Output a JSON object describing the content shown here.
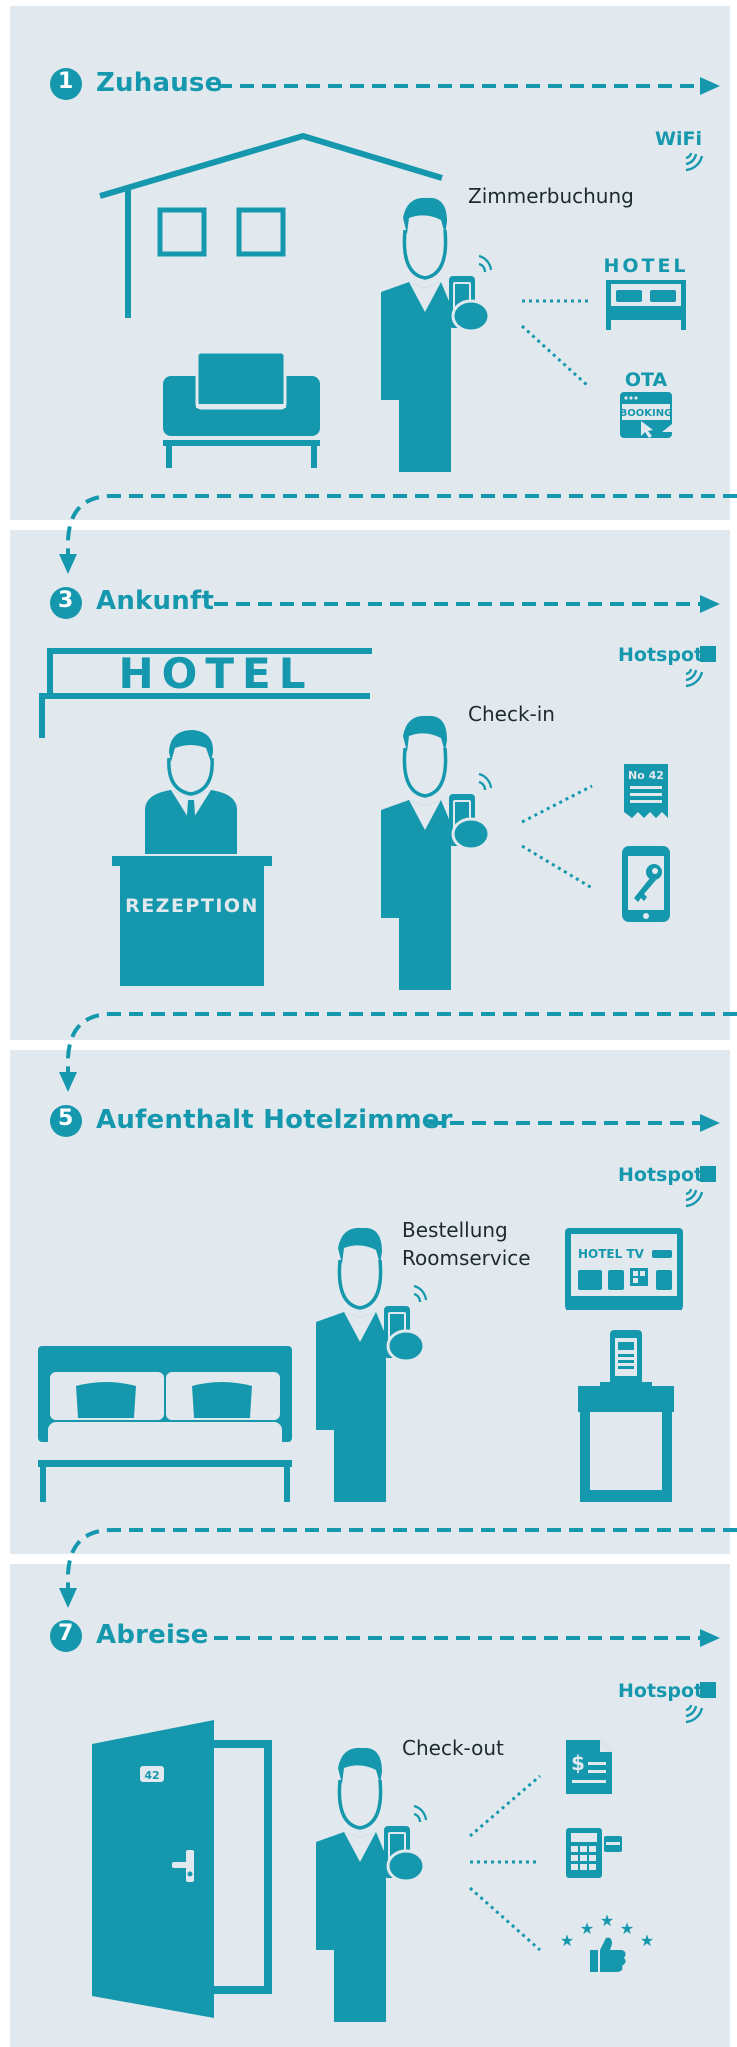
{
  "colors": {
    "teal": "#1598ad",
    "panel": "#e2e9ee",
    "text": "#1d2b30"
  },
  "steps": [
    {
      "number": "1",
      "title": "Zuhause",
      "network": "WiFi",
      "action": "Zimmerbuchung",
      "targets": [
        "HOTEL",
        "OTA",
        "BOOKING"
      ]
    },
    {
      "number": "3",
      "title": "Ankunft",
      "network": "Hotspot",
      "action": "Check-in",
      "sign": "HOTEL",
      "desk": "REZEPTION",
      "receipt": "No 42"
    },
    {
      "number": "5",
      "title": "Aufenthalt Hotelzimmer",
      "network": "Hotspot",
      "action_line1": "Bestellung",
      "action_line2": "Roomservice",
      "tv": "HOTEL TV"
    },
    {
      "number": "7",
      "title": "Abreise",
      "network": "Hotspot",
      "action": "Check-out",
      "door_number": "42"
    }
  ]
}
